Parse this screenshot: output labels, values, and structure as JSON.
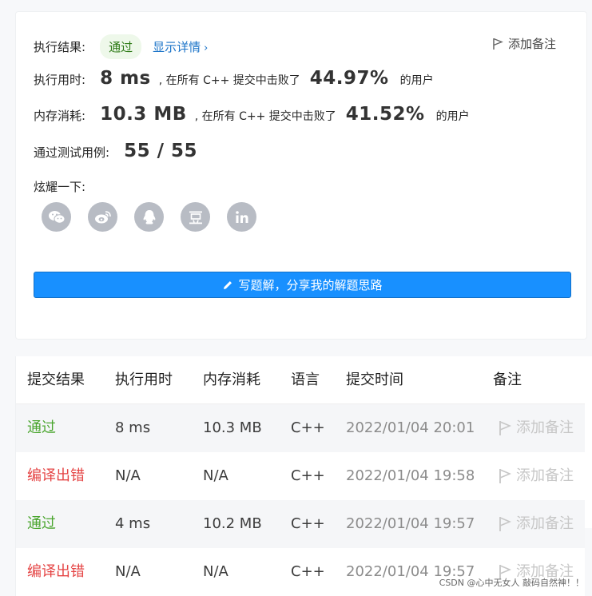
{
  "summary": {
    "result_label": "执行结果:",
    "result_status": "通过",
    "detail_link": "显示详情",
    "add_note": "添加备注",
    "runtime_label": "执行用时:",
    "runtime_value": "8 ms",
    "runtime_text": ", 在所有 C++ 提交中击败了",
    "runtime_percent": "44.97%",
    "users_suffix": "的用户",
    "memory_label": "内存消耗:",
    "memory_value": "10.3 MB",
    "memory_text": ", 在所有 C++ 提交中击败了",
    "memory_percent": "41.52%",
    "tests_label": "通过测试用例:",
    "tests_value": "55 / 55",
    "share_label": "炫耀一下:",
    "share_icons": [
      "wechat-icon",
      "weibo-icon",
      "qq-icon",
      "douban-icon",
      "linkedin-icon"
    ],
    "write_button": "写题解，分享我的解题思路"
  },
  "table": {
    "headers": [
      "提交结果",
      "执行用时",
      "内存消耗",
      "语言",
      "提交时间",
      "备注"
    ],
    "rows": [
      {
        "result": "通过",
        "runtime": "8 ms",
        "memory": "10.3 MB",
        "lang": "C++",
        "time": "2022/01/04 20:01",
        "note": "添加备注",
        "status": "pass"
      },
      {
        "result": "编译出错",
        "runtime": "N/A",
        "memory": "N/A",
        "lang": "C++",
        "time": "2022/01/04 19:58",
        "note": "添加备注",
        "status": "error"
      },
      {
        "result": "通过",
        "runtime": "4 ms",
        "memory": "10.2 MB",
        "lang": "C++",
        "time": "2022/01/04 19:57",
        "note": "添加备注",
        "status": "pass"
      },
      {
        "result": "编译出错",
        "runtime": "N/A",
        "memory": "N/A",
        "lang": "C++",
        "time": "2022/01/04 19:57",
        "note": "添加备注",
        "status": "error"
      }
    ]
  },
  "watermark": "CSDN @心中无女人 敲码自然神！！",
  "colors": {
    "pass": "#4aa52e",
    "error": "#e54545",
    "primary": "#1890ff"
  }
}
